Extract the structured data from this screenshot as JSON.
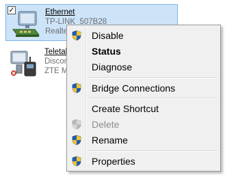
{
  "connections": [
    {
      "checked": true,
      "name": "Ethernet",
      "line2": "TP-LINK_507B28",
      "line3": "Realtek PCIe GBE Family Controller"
    },
    {
      "name": "Teletalk",
      "line2": "Disconnected",
      "line3": "ZTE Mobile Broadband"
    }
  ],
  "context_menu": {
    "items": [
      {
        "label": "Disable",
        "icon": "uac-shield-icon"
      },
      {
        "label": "Status",
        "bold": true
      },
      {
        "label": "Diagnose"
      },
      {
        "label": "Bridge Connections",
        "icon": "uac-shield-icon"
      },
      {
        "label": "Create Shortcut"
      },
      {
        "label": "Delete",
        "icon": "uac-shield-icon",
        "disabled": true
      },
      {
        "label": "Rename",
        "icon": "uac-shield-icon"
      },
      {
        "label": "Properties",
        "icon": "uac-shield-icon"
      }
    ]
  },
  "colors": {
    "selection": "#cde3f8",
    "menu_background": "#f0f0f0",
    "shield_blue": "#1f5fb8",
    "shield_yellow": "#f2c32a"
  }
}
